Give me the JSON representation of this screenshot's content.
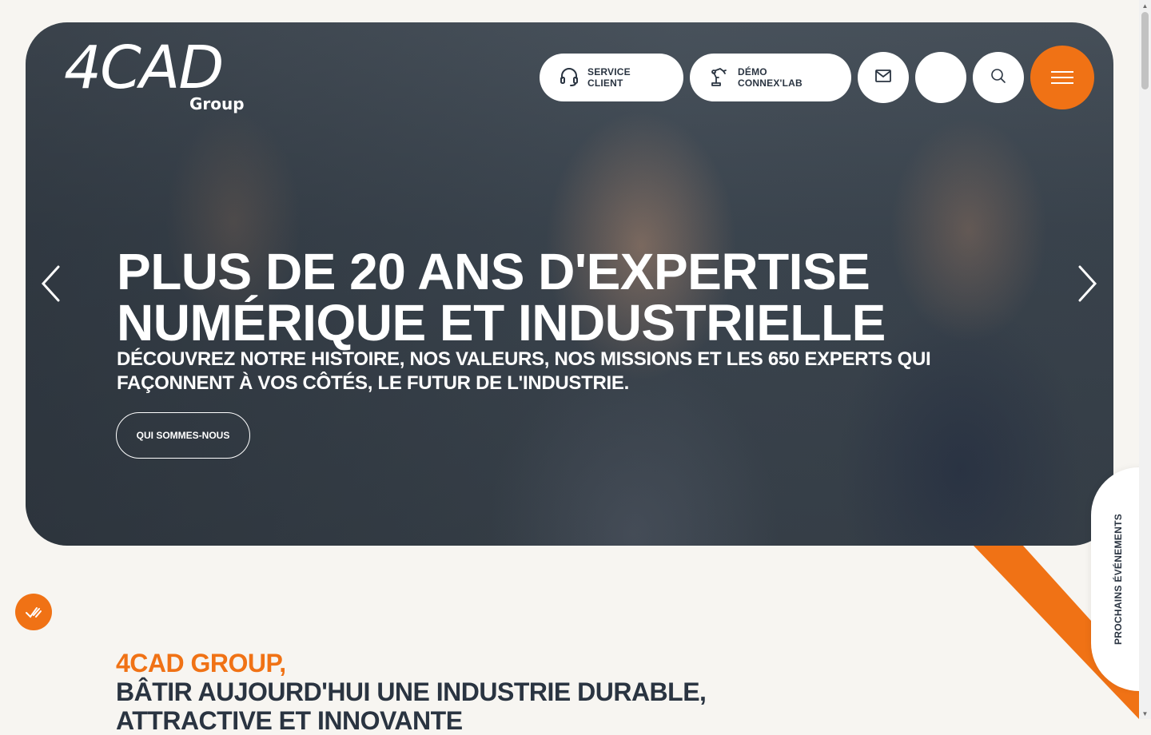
{
  "brand": {
    "logo_main": "4CAD",
    "logo_sub": "Group"
  },
  "header": {
    "service_client": "SERVICE CLIENT",
    "demo_connexlab": "DÉMO CONNEX'LAB"
  },
  "hero": {
    "headline_line1": "PLUS DE 20 ANS D'EXPERTISE",
    "headline_line2": "NUMÉRIQUE ET INDUSTRIELLE",
    "subtitle": "DÉCOUVREZ NOTRE HISTOIRE, NOS VALEURS, NOS MISSIONS ET LES 650 EXPERTS QUI FAÇONNENT À VOS CÔTÉS, LE FUTUR DE L'INDUSTRIE.",
    "cta_label": "QUI SOMMES-NOUS"
  },
  "side_tab": {
    "label": "PROCHAINS ÉVÉNEMENTS"
  },
  "section": {
    "kicker": "4CAD GROUP,",
    "title": "BÂTIR AUJOURD'HUI UNE INDUSTRIE DURABLE, ATTRACTIVE ET INNOVANTE"
  },
  "colors": {
    "accent": "#f07215",
    "dark": "#2a3441",
    "background": "#f7f5f1"
  },
  "icons": {
    "service": "headset-icon",
    "demo": "robot-arm-icon",
    "mail": "mail-icon",
    "search": "search-icon",
    "menu": "hamburger-icon",
    "prev": "chevron-left-icon",
    "next": "chevron-right-icon",
    "badge": "accessibility-icon"
  }
}
